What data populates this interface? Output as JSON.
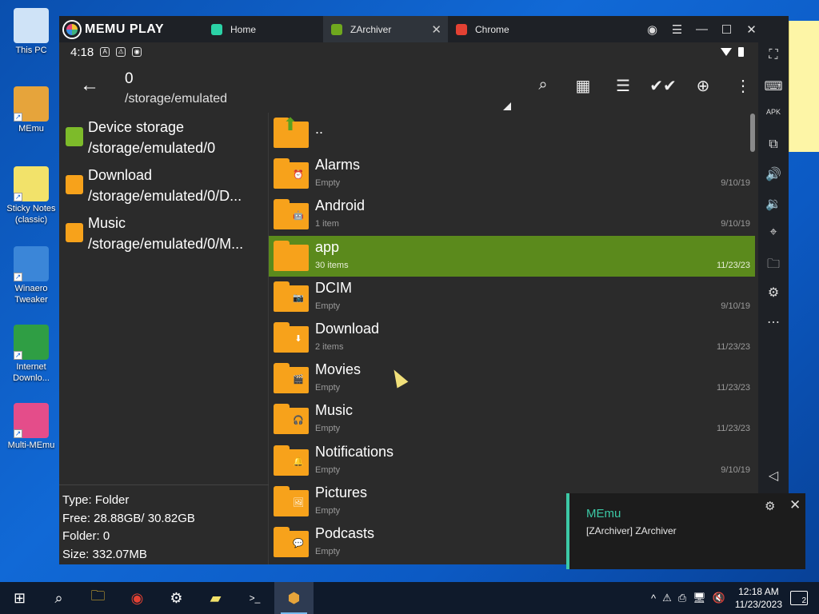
{
  "desktop": {
    "icons": [
      {
        "label": "This PC",
        "icon": "computer-icon",
        "color": "#cfe3f7"
      },
      {
        "label": "MEmu",
        "icon": "memu-icon",
        "color": "#e6a43b"
      },
      {
        "label": "Sticky Notes (classic)",
        "icon": "sticky-notes-icon",
        "color": "#f2e26a"
      },
      {
        "label": "Winaero Tweaker",
        "icon": "winaero-icon",
        "color": "#3b86d8"
      },
      {
        "label": "Internet Downlo...",
        "icon": "download-manager-icon",
        "color": "#2f9e44"
      },
      {
        "label": "Multi-MEmu",
        "icon": "multi-memu-icon",
        "color": "#e44d8a"
      }
    ]
  },
  "emulator": {
    "brand": "MEMU PLAY",
    "tabs": [
      {
        "label": "Home",
        "icon": "home-icon",
        "color": "#2bd2a6"
      },
      {
        "label": "ZArchiver",
        "icon": "zarchiver-icon",
        "color": "#6fa81e"
      },
      {
        "label": "Chrome",
        "icon": "chrome-icon",
        "color": "#e34133"
      }
    ],
    "tab_close": "✕",
    "window_controls": [
      "◉",
      "☰",
      "—",
      "☐",
      "✕",
      "‹‹‹"
    ]
  },
  "status_bar": {
    "time": "4:18",
    "icons": [
      "A",
      "⚠",
      "◉"
    ],
    "right_icons": [
      "wifi-icon",
      "battery-icon"
    ]
  },
  "toolbar": {
    "back": "←",
    "count": "0",
    "path": "/storage/emulated",
    "actions": [
      "⌕",
      "▦",
      "☰",
      "✔✔",
      "⊕",
      "⋮"
    ]
  },
  "storages": [
    {
      "name": "Device storage",
      "path": "/storage/emulated/0",
      "color": "#7dbb2a"
    },
    {
      "name": "Download",
      "path": "/storage/emulated/0/D...",
      "color": "#f7a21b"
    },
    {
      "name": "Music",
      "path": "/storage/emulated/0/M...",
      "color": "#f7a21b"
    }
  ],
  "info": {
    "type": "Type: Folder",
    "free": "Free: 28.88GB/ 30.82GB",
    "folder": "Folder: 0",
    "size": "Size: 332.07MB"
  },
  "files": [
    {
      "name": "..",
      "meta": "",
      "date": "",
      "badge": "⬆",
      "selected": false
    },
    {
      "name": "Alarms",
      "meta": "Empty",
      "date": "9/10/19",
      "badge": "⏰",
      "selected": false
    },
    {
      "name": "Android",
      "meta": "1 item",
      "date": "9/10/19",
      "badge": "🤖",
      "selected": false
    },
    {
      "name": "app",
      "meta": "30 items",
      "date": "11/23/23",
      "badge": "",
      "selected": true
    },
    {
      "name": "DCIM",
      "meta": "Empty",
      "date": "9/10/19",
      "badge": "📷",
      "selected": false
    },
    {
      "name": "Download",
      "meta": "2 items",
      "date": "11/23/23",
      "badge": "⬇",
      "selected": false
    },
    {
      "name": "Movies",
      "meta": "Empty",
      "date": "11/23/23",
      "badge": "🎬",
      "selected": false
    },
    {
      "name": "Music",
      "meta": "Empty",
      "date": "11/23/23",
      "badge": "🎧",
      "selected": false
    },
    {
      "name": "Notifications",
      "meta": "Empty",
      "date": "9/10/19",
      "badge": "🔔",
      "selected": false
    },
    {
      "name": "Pictures",
      "meta": "Empty",
      "date": "",
      "badge": "🖼",
      "selected": false
    },
    {
      "name": "Podcasts",
      "meta": "Empty",
      "date": "",
      "badge": "💬",
      "selected": false
    }
  ],
  "sidebar": {
    "buttons": [
      "⛶",
      "⌨",
      "APK",
      "⧉",
      "🔊",
      "🔉",
      "⌖",
      "🗀",
      "⚙",
      "⋯",
      "◁"
    ]
  },
  "toast": {
    "title": "MEmu",
    "body": "[ZArchiver] ZArchiver",
    "accent": "#3cc9a6"
  },
  "taskbar": {
    "items": [
      "⊞",
      "⌕",
      "🗀",
      "◉",
      "⚙",
      "▰",
      ">_",
      "⬢"
    ],
    "tray_icons": [
      "^",
      "⚠",
      "⎙",
      "🖥",
      "🔇"
    ],
    "time": "12:18 AM",
    "date": "11/23/2023",
    "notification_count": "2"
  }
}
